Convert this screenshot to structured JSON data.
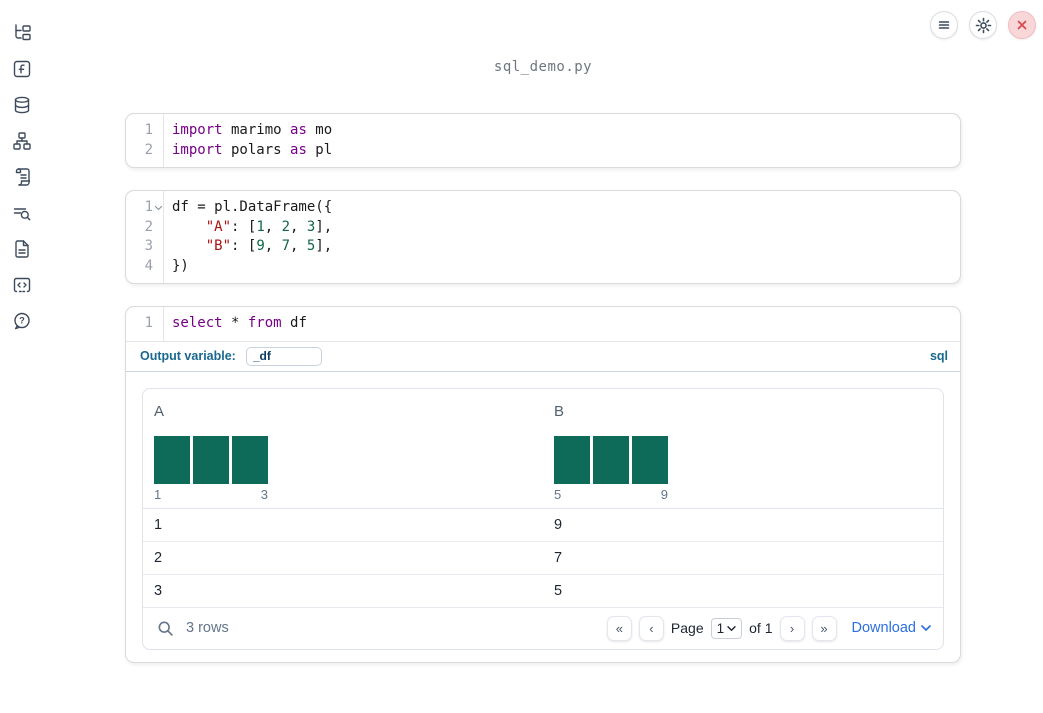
{
  "window": {
    "title": "sql_demo.py"
  },
  "topbar": {
    "menu_button": "menu",
    "settings_button": "settings",
    "close_button": "close"
  },
  "sidebar": {
    "items": [
      {
        "id": "file-explorer"
      },
      {
        "id": "variables"
      },
      {
        "id": "data-sources"
      },
      {
        "id": "dependency-graph"
      },
      {
        "id": "logs"
      },
      {
        "id": "outline-search"
      },
      {
        "id": "documentation"
      },
      {
        "id": "snippets"
      },
      {
        "id": "help"
      }
    ]
  },
  "cells": [
    {
      "type": "python",
      "lines": [
        {
          "num": "1",
          "tokens": [
            {
              "t": "kw",
              "v": "import"
            },
            {
              "t": "pl",
              "v": " marimo "
            },
            {
              "t": "kw",
              "v": "as"
            },
            {
              "t": "pl",
              "v": " mo"
            }
          ]
        },
        {
          "num": "2",
          "tokens": [
            {
              "t": "kw",
              "v": "import"
            },
            {
              "t": "pl",
              "v": " polars "
            },
            {
              "t": "kw",
              "v": "as"
            },
            {
              "t": "pl",
              "v": " pl"
            }
          ]
        }
      ]
    },
    {
      "type": "python",
      "lines": [
        {
          "num": "1",
          "fold": true,
          "tokens": [
            {
              "t": "pl",
              "v": "df = pl.DataFrame({"
            }
          ]
        },
        {
          "num": "2",
          "tokens": [
            {
              "t": "pl",
              "v": "    "
            },
            {
              "t": "str",
              "v": "\"A\""
            },
            {
              "t": "pl",
              "v": ": ["
            },
            {
              "t": "num",
              "v": "1"
            },
            {
              "t": "pl",
              "v": ", "
            },
            {
              "t": "num",
              "v": "2"
            },
            {
              "t": "pl",
              "v": ", "
            },
            {
              "t": "num",
              "v": "3"
            },
            {
              "t": "pl",
              "v": "],"
            }
          ]
        },
        {
          "num": "3",
          "tokens": [
            {
              "t": "pl",
              "v": "    "
            },
            {
              "t": "str",
              "v": "\"B\""
            },
            {
              "t": "pl",
              "v": ": ["
            },
            {
              "t": "num",
              "v": "9"
            },
            {
              "t": "pl",
              "v": ", "
            },
            {
              "t": "num",
              "v": "7"
            },
            {
              "t": "pl",
              "v": ", "
            },
            {
              "t": "num",
              "v": "5"
            },
            {
              "t": "pl",
              "v": "],"
            }
          ]
        },
        {
          "num": "4",
          "tokens": [
            {
              "t": "pl",
              "v": "})"
            }
          ]
        }
      ]
    },
    {
      "type": "sql",
      "lines": [
        {
          "num": "1",
          "tokens": [
            {
              "t": "kw",
              "v": "select"
            },
            {
              "t": "pl",
              "v": " * "
            },
            {
              "t": "kw",
              "v": "from"
            },
            {
              "t": "pl",
              "v": " df"
            }
          ]
        }
      ]
    }
  ],
  "sql_cell": {
    "output_variable_label": "Output variable:",
    "output_variable_value": "_df",
    "language_badge": "sql"
  },
  "table": {
    "columns": [
      {
        "name": "A",
        "histogram": {
          "bars": [
            1,
            1,
            1
          ],
          "min_label": "1",
          "max_label": "3"
        }
      },
      {
        "name": "B",
        "histogram": {
          "bars": [
            1,
            1,
            1
          ],
          "min_label": "5",
          "max_label": "9"
        }
      }
    ],
    "rows": [
      [
        "1",
        "9"
      ],
      [
        "2",
        "7"
      ],
      [
        "3",
        "5"
      ]
    ],
    "footer": {
      "row_count": "3 rows",
      "pagination": {
        "first": "«",
        "prev": "‹",
        "page_label": "Page",
        "page_value": "1",
        "of_label": "of 1",
        "next": "›",
        "last": "»"
      },
      "download_label": "Download"
    }
  },
  "colors": {
    "accent_blue": "#19688f",
    "link_blue": "#2b6fe2",
    "histogram_bar_teal": "#0e6b59",
    "close_red": "#d9484e",
    "code_keyword": "#770088",
    "code_string": "#aa1111",
    "code_number": "#116644"
  }
}
